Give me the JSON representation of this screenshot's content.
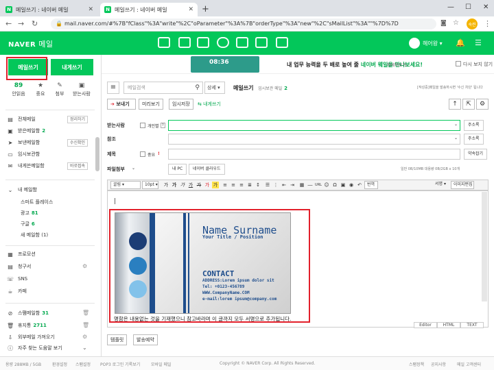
{
  "browser": {
    "tabs": [
      {
        "title": "메일쓰기 : 네이버 메일",
        "active": false
      },
      {
        "title": "메일쓰기 : 네이버 메일",
        "active": true
      }
    ],
    "url": "mail.naver.com/#%7B\"fClass\"%3A\"write\"%2C\"oParameter\"%3A%7B\"orderType\"%3A\"new\"%2C\"sMailList\"%3A\"\"%7D%7D",
    "profile_label": "숙련"
  },
  "header": {
    "logo_naver": "NAVER",
    "logo_service": "메일",
    "user_name": "헤어왕",
    "brand_color": "#03c75a",
    "apps": [
      "mail-icon",
      "calendar-icon",
      "contacts-icon",
      "cloud-icon",
      "memo-icon",
      "office-icon",
      "more-icon"
    ]
  },
  "sidebar": {
    "write_label": "메일쓰기",
    "self_label": "내게쓰기",
    "stats": [
      {
        "value": "89",
        "label": "안읽음",
        "icon": ""
      },
      {
        "value": "",
        "label": "중요",
        "icon": "star-icon"
      },
      {
        "value": "",
        "label": "첨부",
        "icon": "clip-icon"
      },
      {
        "value": "",
        "label": "받는사람",
        "icon": "to-icon"
      }
    ],
    "folders": [
      {
        "label": "전체메일",
        "count": "",
        "button": "정리하기"
      },
      {
        "label": "받은메일함",
        "count": "2",
        "button": ""
      },
      {
        "label": "보낸메일함",
        "count": "",
        "button": "수신확인"
      },
      {
        "label": "임시보관함",
        "count": "",
        "button": ""
      },
      {
        "label": "내게쓴메일함",
        "count": "",
        "button": "바로접속"
      }
    ],
    "my_folders_label": "내 메일함",
    "my_folders": [
      {
        "label": "스마트 플레이스",
        "count": ""
      },
      {
        "label": "광고",
        "count": "81"
      },
      {
        "label": "구글",
        "count": "6"
      },
      {
        "label": "새 메일함 (1)",
        "count": ""
      }
    ],
    "extras": [
      {
        "label": "프로모션"
      },
      {
        "label": "청구서"
      },
      {
        "label": "SNS"
      },
      {
        "label": "카페"
      }
    ],
    "spam_label": "스팸메일함",
    "spam_count": "31",
    "trash_label": "휴지통",
    "trash_count": "2711",
    "external_label": "외부메일 가져오기",
    "help_label": "자주 찾는 도움말 보기"
  },
  "banner": {
    "clock": "08:36",
    "text_prefix": "내 업무 능력을 두 배로 높여 줄",
    "text_highlight": "네이버 웨일을 만나보세요!",
    "link": "자세히보기",
    "close_label": "다시 보지 않기"
  },
  "toolbar": {
    "search_placeholder": "메일검색",
    "detail_label": "상세",
    "mail_title": "메일쓰기",
    "draft_label": "임시보관 메일",
    "draft_count": "2",
    "hint": "[작성중]메일을 발송하시면 '수신 차단' 됩니다"
  },
  "actions": {
    "send": "보내기",
    "preview": "미리보기",
    "save": "임시저장",
    "self": "내게쓰기"
  },
  "form": {
    "to_label": "받는사람",
    "individual_label": "개인별",
    "address_book": "주소록",
    "cc_label": "참조",
    "subject_label": "제목",
    "important_label": "중요",
    "bookmark": "약속잡기",
    "attach_label": "파일첨부",
    "my_pc": "내 PC",
    "ndrive": "네이버 클라우드",
    "quota_text": "일반 0B/10MB  대용량 0B/2GB x 10개"
  },
  "editor": {
    "font": "굴림",
    "size": "10pt",
    "translate": "번역",
    "signature": "서명",
    "img_edit": "이미지편집",
    "sig_text": "명함은 내용없는 것을 기재했으니 참고바라며 이 글까지 모두 서명으로 추가됩니다.",
    "tabs": [
      "Editor",
      "HTML",
      "TEXT"
    ]
  },
  "card": {
    "name": "Name Surname",
    "title": "Your Title / Position",
    "contact": "CONTACT",
    "lines": [
      "ADDRESS:Lorem ipsum dolor sit",
      "Tel: +0123-456789",
      "WWW.CompanyName.COM",
      "e-mail:lorem ipsum@company.com"
    ]
  },
  "bottom": {
    "template": "템플릿",
    "reserve": "발송예약"
  },
  "footer": {
    "quota": "용량 288MB / 5GB",
    "items": [
      "환경설정",
      "스팸설정",
      "POP3 로그인 기록보기",
      "모바일 메일"
    ],
    "copyright": "Copyright © NAVER Corp. All Rights Reserved.",
    "right": [
      "스팸정책",
      "공지사항",
      "메일 고객센터"
    ]
  }
}
